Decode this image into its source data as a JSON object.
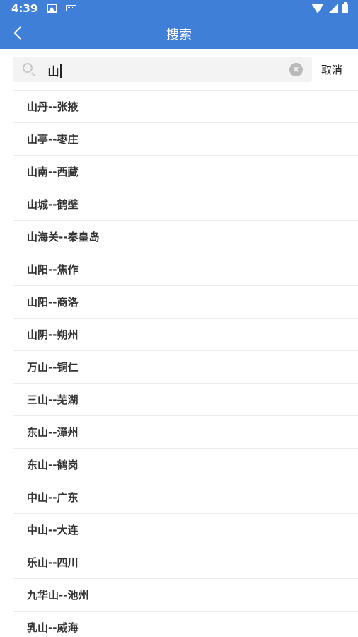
{
  "status_bar": {
    "time": "4:39",
    "icons": [
      "image-icon",
      "keyboard-icon",
      "wifi-icon",
      "signal-icon",
      "battery-icon"
    ]
  },
  "app_bar": {
    "title": "搜索",
    "back_icon": "chevron-left-icon",
    "background": "#3f7fd8"
  },
  "search": {
    "value": "山",
    "icon": "search-icon",
    "clear_icon": "clear-icon",
    "cancel_label": "取消"
  },
  "results": [
    "山丹--张掖",
    "山亭--枣庄",
    "山南--西藏",
    "山城--鹤壁",
    "山海关--秦皇岛",
    "山阳--焦作",
    "山阳--商洛",
    "山阴--朔州",
    "万山--铜仁",
    "三山--芜湖",
    "东山--漳州",
    "东山--鹤岗",
    "中山--广东",
    "中山--大连",
    "乐山--四川",
    "九华山--池州",
    "乳山--威海"
  ]
}
